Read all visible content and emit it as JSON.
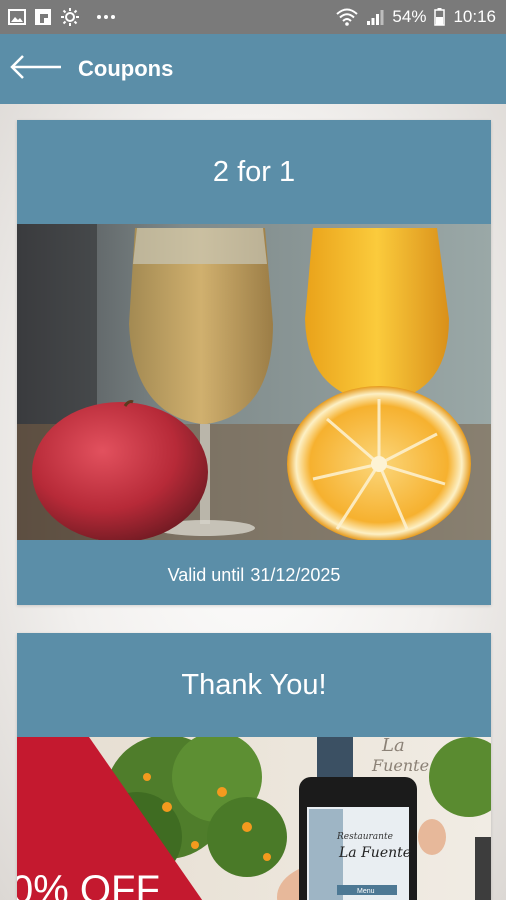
{
  "status_bar": {
    "battery": "54%",
    "time": "10:16",
    "icons": [
      "gallery-icon",
      "flipboard-icon",
      "brightness-icon",
      "more-dots-icon",
      "wifi-icon",
      "signal-icon",
      "battery-icon"
    ]
  },
  "app_bar": {
    "title": "Coupons",
    "back_icon": "arrow-left-icon"
  },
  "coupons": [
    {
      "title": "2 for 1",
      "valid_label": "Valid until",
      "valid_date": "31/12/2025",
      "image": "juice-glasses-with-apple-and-orange"
    },
    {
      "title": "Thank You!",
      "image": "restaurant-app-on-phone-with-discount-banner",
      "image_text": {
        "banner": "0% OFF",
        "phone_line1": "Restaurante",
        "phone_line2": "La Fuente",
        "phone_button": "Menu",
        "wall_sign": "La Fuente"
      }
    }
  ],
  "colors": {
    "accent": "#5b8ea8",
    "status_bar": "#7a7a7a",
    "banner_red": "#c4192f"
  }
}
